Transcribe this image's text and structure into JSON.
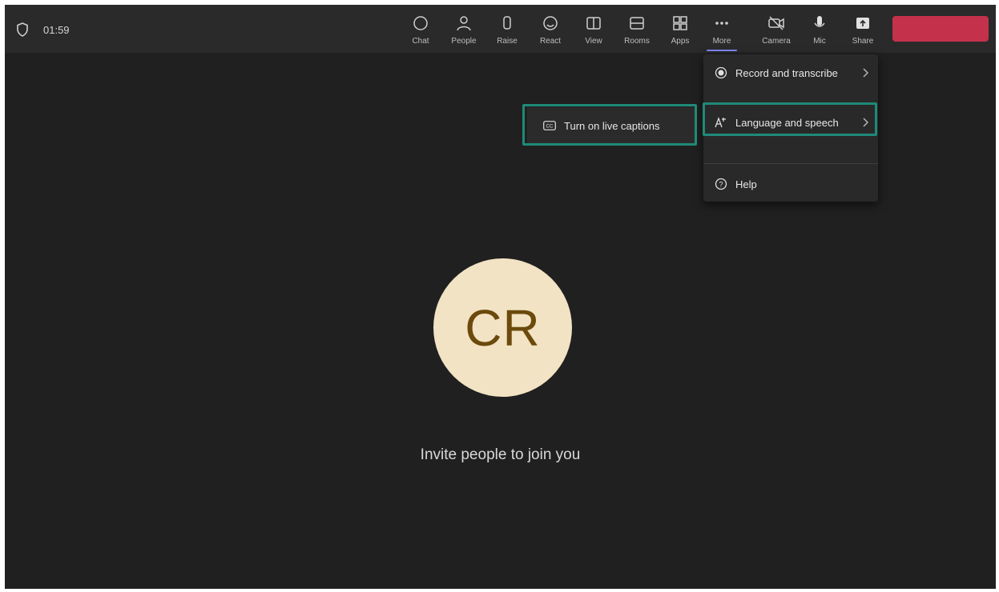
{
  "header": {
    "timer": "01:59"
  },
  "toolbar": {
    "items": [
      {
        "label": "Chat",
        "icon": "chat-icon"
      },
      {
        "label": "People",
        "icon": "people-icon"
      },
      {
        "label": "Raise",
        "icon": "raise-hand-icon"
      },
      {
        "label": "React",
        "icon": "react-icon"
      },
      {
        "label": "View",
        "icon": "view-icon"
      },
      {
        "label": "Rooms",
        "icon": "rooms-icon"
      },
      {
        "label": "Apps",
        "icon": "apps-icon"
      },
      {
        "label": "More",
        "icon": "more-icon"
      },
      {
        "label": "Camera",
        "icon": "camera-off-icon"
      },
      {
        "label": "Mic",
        "icon": "mic-icon"
      },
      {
        "label": "Share",
        "icon": "share-icon"
      }
    ]
  },
  "more_menu": {
    "record": "Record and transcribe",
    "language": "Language and speech",
    "help": "Help"
  },
  "submenu": {
    "captions": "Turn on live captions"
  },
  "stage": {
    "avatar_initials": "CR",
    "invite_text": "Invite people to join you"
  },
  "colors": {
    "accent": "#7f85f5",
    "highlight": "#1f8a78",
    "avatar_bg": "#f2e3c4",
    "avatar_text": "#6b4a0c",
    "leave": "#c4314b"
  }
}
